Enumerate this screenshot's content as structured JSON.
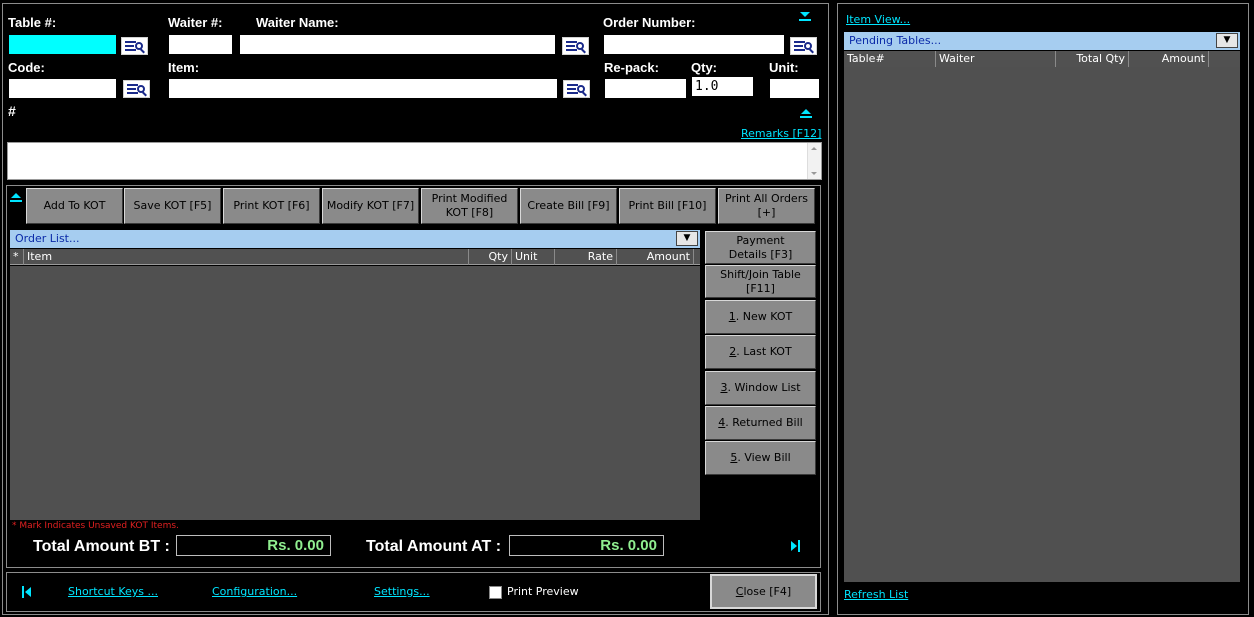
{
  "fields": {
    "table_label": "Table #:",
    "waiter_no_label": "Waiter #:",
    "waiter_name_label": "Waiter Name:",
    "order_number_label": "Order Number:",
    "code_label": "Code:",
    "item_label": "Item:",
    "repack_label": "Re-pack:",
    "qty_label": "Qty:",
    "unit_label": "Unit:",
    "qty_value": "1.0",
    "hash_label": "#",
    "remarks_link": "Remarks [F12]"
  },
  "kot_buttons": [
    {
      "label": "Add To KOT"
    },
    {
      "label": "Save KOT  [F5]"
    },
    {
      "label": "Print KOT  [F6]"
    },
    {
      "label": "Modify KOT [F7]"
    },
    {
      "label": "Print Modified KOT [F8]"
    },
    {
      "label": "Create Bill  [F9]"
    },
    {
      "label": "Print Bill  [F10]"
    },
    {
      "label": "Print All Orders [+]"
    }
  ],
  "order_list": {
    "title": "Order List...",
    "dropdown_glyph": "▼",
    "columns": [
      "*",
      "Item",
      "Qty",
      "Unit",
      "Rate",
      "Amount"
    ],
    "rows": [],
    "note": "* Mark Indicates Unsaved KOT Items."
  },
  "side_buttons": {
    "payment_details": "Payment Details [F3]",
    "shift_join": "Shift/Join Table [F11]",
    "new_kot": {
      "key": "1",
      "rest": ". New KOT"
    },
    "last_kot": {
      "key": "2",
      "rest": ". Last KOT"
    },
    "window_list": {
      "key": "3",
      "rest": ". Window List"
    },
    "returned_bill": {
      "key": "4",
      "rest": ". Returned Bill"
    },
    "view_bill": {
      "key": "5",
      "rest": ". View Bill"
    }
  },
  "totals": {
    "bt_label": "Total Amount BT :",
    "bt_value": "Rs. 0.00",
    "at_label": "Total Amount AT :",
    "at_value": "Rs. 0.00"
  },
  "footer": {
    "shortcut_keys": "Shortcut Keys ...",
    "configuration": "Configuration...",
    "settings": "Settings...",
    "print_preview_label": "Print Preview",
    "print_preview_checked": false,
    "close": {
      "key": "C",
      "rest": "lose [F4]"
    }
  },
  "right_panel": {
    "item_view_link": "Item View...",
    "pending_title": "Pending Tables...",
    "dropdown_glyph": "▼",
    "columns": [
      "Table#",
      "Waiter",
      "Total Qty",
      "Amount"
    ],
    "rows": [],
    "refresh_link": "Refresh List"
  },
  "colors": {
    "accent": "#00e5ff",
    "focused_field": "#00ffff",
    "banner": "#a6cdf0",
    "grid_bg": "#505050",
    "total_text": "#90ee90",
    "note_red": "#e02020"
  }
}
